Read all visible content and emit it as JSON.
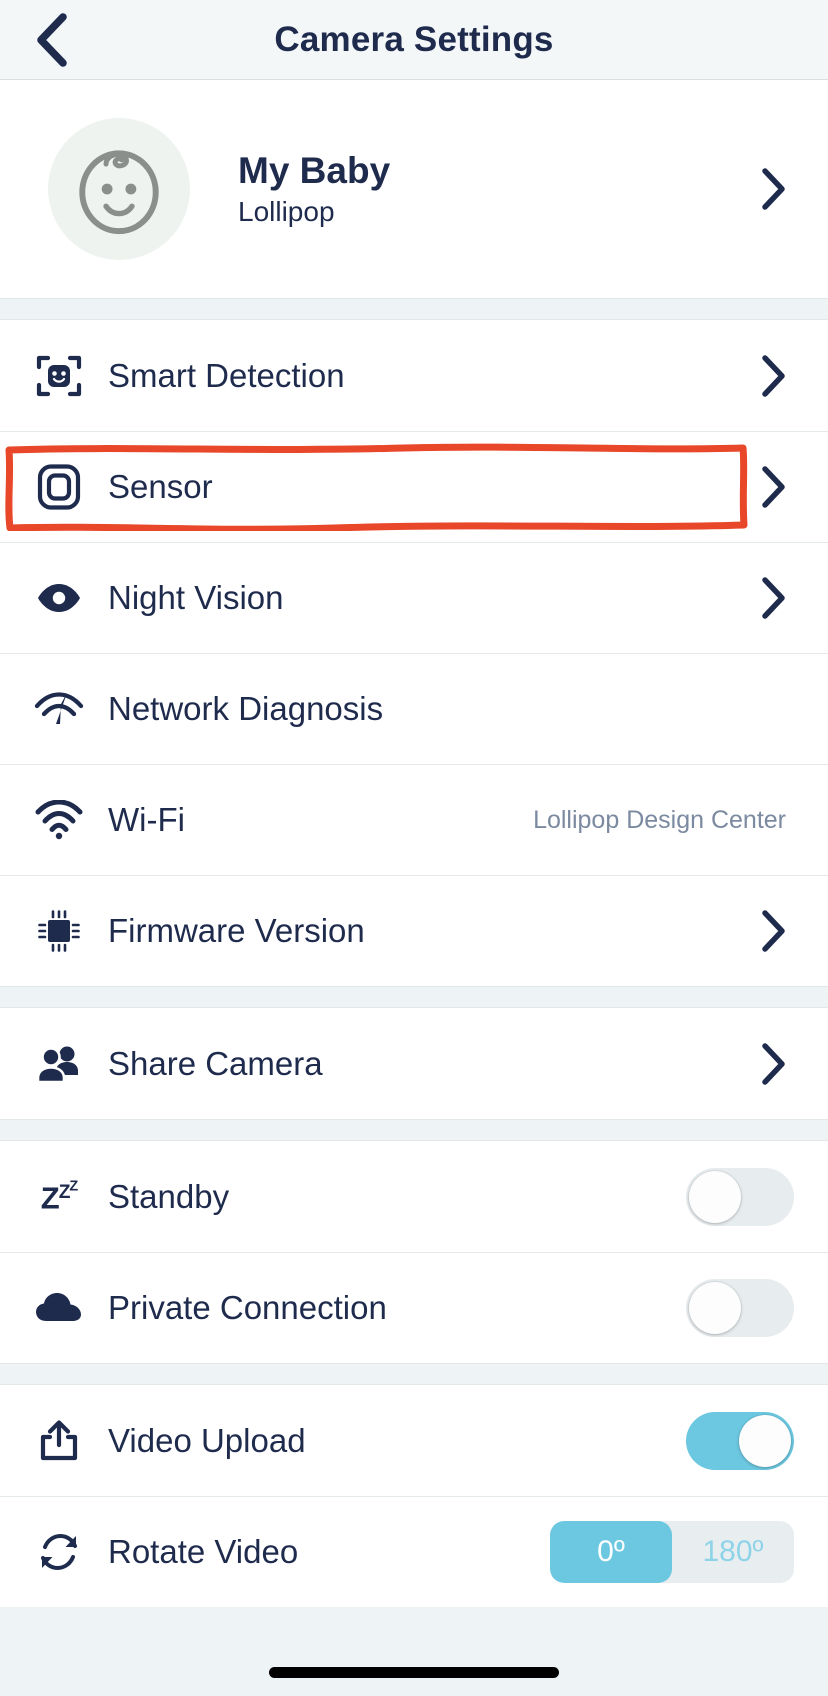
{
  "header": {
    "title": "Camera Settings",
    "back_icon": "chevron-left-icon"
  },
  "profile": {
    "avatar_icon": "baby-face-icon",
    "name": "My Baby",
    "subtitle": "Lollipop",
    "chevron": "chevron-right-icon"
  },
  "colors": {
    "accent": "#6cc7e0",
    "text": "#1f2b4d",
    "muted": "#7b8aa0",
    "header_bg": "#f4f7f8",
    "section_gap": "#eef3f5",
    "highlight": "#e8472a",
    "toggle_off": "#e7ecee"
  },
  "sections": [
    {
      "rows": [
        {
          "icon": "face-detection-icon",
          "label": "Smart Detection",
          "type": "link",
          "highlighted": false
        },
        {
          "icon": "sensor-icon",
          "label": "Sensor",
          "type": "link",
          "highlighted": true
        },
        {
          "icon": "eye-icon",
          "label": "Night Vision",
          "type": "link",
          "highlighted": false
        },
        {
          "icon": "network-speed-icon",
          "label": "Network Diagnosis",
          "type": "plain",
          "highlighted": false
        },
        {
          "icon": "wifi-icon",
          "label": "Wi-Fi",
          "type": "value",
          "value": "Lollipop Design Center",
          "highlighted": false
        },
        {
          "icon": "chip-icon",
          "label": "Firmware Version",
          "type": "link",
          "highlighted": false
        }
      ]
    },
    {
      "rows": [
        {
          "icon": "people-icon",
          "label": "Share Camera",
          "type": "link",
          "highlighted": false
        }
      ]
    },
    {
      "rows": [
        {
          "icon": "zzz-icon",
          "label": "Standby",
          "type": "toggle",
          "toggle_on": false,
          "highlighted": false
        },
        {
          "icon": "cloud-icon",
          "label": "Private Connection",
          "type": "toggle",
          "toggle_on": false,
          "highlighted": false
        }
      ]
    },
    {
      "rows": [
        {
          "icon": "upload-icon",
          "label": "Video Upload",
          "type": "toggle",
          "toggle_on": true,
          "highlighted": false
        },
        {
          "icon": "rotate-icon",
          "label": "Rotate Video",
          "type": "segmented",
          "options": [
            "0º",
            "180º"
          ],
          "selected_index": 0,
          "highlighted": false
        }
      ]
    }
  ]
}
